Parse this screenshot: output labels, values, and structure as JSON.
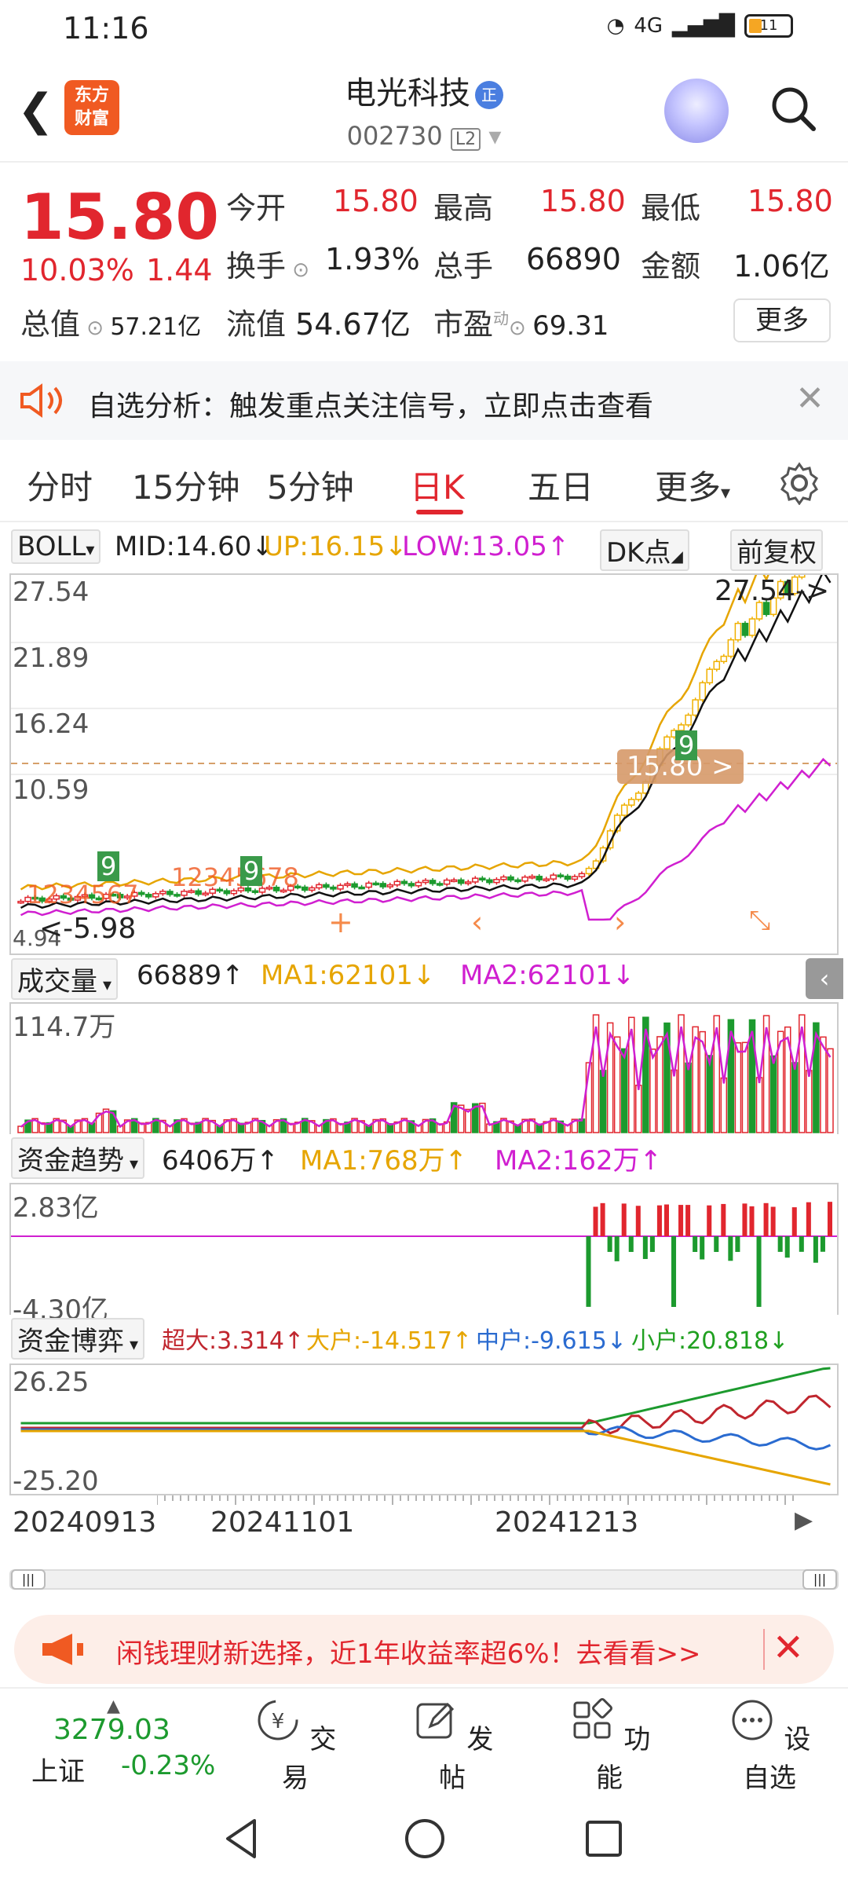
{
  "status": {
    "time": "11:16",
    "net": "4G",
    "battery": "11"
  },
  "header": {
    "logo": "东方\n财富",
    "name": "电光科技",
    "badge": "正",
    "code": "002730",
    "level": "L2"
  },
  "quote": {
    "price": "15.80",
    "pct": "10.03%",
    "change": "1.44",
    "items": [
      {
        "label": "今开",
        "value": "15.80"
      },
      {
        "label": "最高",
        "value": "15.80"
      },
      {
        "label": "最低",
        "value": "15.80"
      },
      {
        "label": "换手",
        "value": "1.93%"
      },
      {
        "label": "总手",
        "value": "66890"
      },
      {
        "label": "金额",
        "value": "1.06亿"
      },
      {
        "label": "总值",
        "value": "57.21亿"
      },
      {
        "label": "流值",
        "value": "54.67亿"
      },
      {
        "label": "市盈",
        "value": "69.31"
      }
    ],
    "more": "更多"
  },
  "notice": {
    "text": "自选分析：触发重点关注信号，立即点击查看"
  },
  "tabs": [
    "分时",
    "15分钟",
    "5分钟",
    "日K",
    "五日",
    "更多"
  ],
  "boll": {
    "name": "BOLL",
    "mid": "MID:14.60↓",
    "up": "UP:16.15↓",
    "low": "LOW:13.05↑",
    "dk": "DK点",
    "fq": "前复权"
  },
  "kline_axis": [
    "27.54",
    "21.89",
    "16.24",
    "10.59",
    "4.94"
  ],
  "kline_labels": {
    "high": "27.54->",
    "low": "<-5.98",
    "current": "15.80 >",
    "seq1": "1234567",
    "seq2": "12345678",
    "nine": "9"
  },
  "volume": {
    "name": "成交量",
    "value": "66889↑",
    "ma1": "MA1:62101↓",
    "ma2": "MA2:62101↓",
    "axis_top": "114.7万"
  },
  "fund_trend": {
    "name": "资金趋势",
    "value": "6406万↑",
    "ma1": "MA1:768万↑",
    "ma2": "MA2:162万↑",
    "axis_top": "2.83亿",
    "axis_bottom": "-4.30亿"
  },
  "fund_game": {
    "name": "资金博弈",
    "super": "超大:3.314↑",
    "large": "大户:-14.517↑",
    "mid": "中户:-9.615↓",
    "small": "小户:20.818↓",
    "axis_top": "26.25",
    "axis_bottom": "-25.20"
  },
  "dates": [
    "20240913",
    "20241101",
    "20241213"
  ],
  "promo": {
    "text": "闲钱理财新选择，近1年收益率超6%！去看看>>"
  },
  "toolbar": {
    "index_value": "3279.03",
    "index_name": "上证",
    "index_change": "-0.23%",
    "items": [
      "交易",
      "发帖",
      "功能",
      "设自选"
    ]
  },
  "colors": {
    "up": "#e1262e",
    "down": "#1c9a2e",
    "yellow": "#e6a500",
    "magenta": "#d01fd0"
  }
}
